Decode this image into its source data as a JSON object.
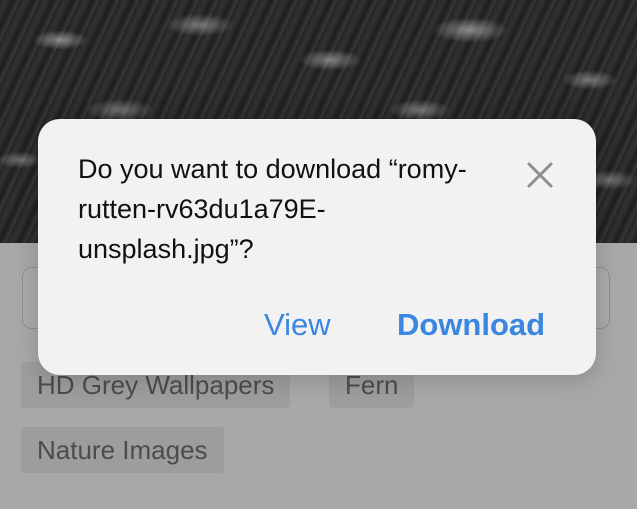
{
  "dialog": {
    "message": "Do you want to download “romy-rutten-rv63du1a79E-unsplash.jpg”?",
    "view_label": "View",
    "download_label": "Download",
    "close_icon": "close-icon"
  },
  "page": {
    "tags": [
      "HD Grey Wallpapers",
      "Fern",
      "Nature Images"
    ]
  },
  "colors": {
    "accent": "#3b86e0",
    "dialog_bg": "#f2f2f2"
  }
}
